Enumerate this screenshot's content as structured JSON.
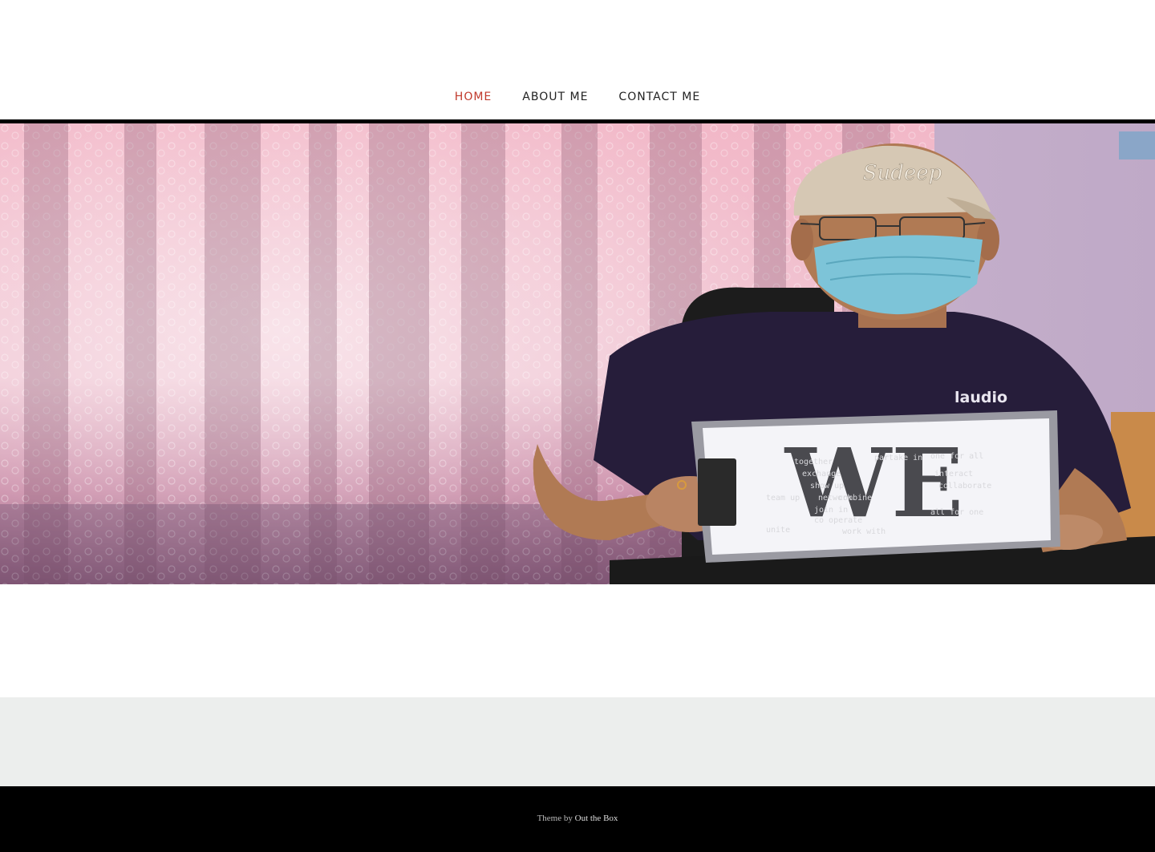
{
  "nav": {
    "items": [
      {
        "label": "HOME",
        "active": true
      },
      {
        "label": "ABOUT ME",
        "active": false
      },
      {
        "label": "CONTACT ME",
        "active": false
      }
    ]
  },
  "hero": {
    "cap_text": "Sudeep",
    "shirt_logo": "laudio",
    "sign": {
      "big_text": "WE",
      "words": [
        "together",
        "exchange",
        "show up",
        "team up",
        "network",
        "join in",
        "co operate",
        "unite",
        "one for all",
        "collaborate",
        "all for one",
        "work with",
        "combine",
        "partake in",
        "interact"
      ]
    },
    "colors": {
      "curtain": "#e9a4b8",
      "wall": "#cbb7cf",
      "shirt": "#241c38",
      "mask": "#7dc4d8"
    }
  },
  "footer": {
    "credit_prefix": "Theme by ",
    "credit_link": "Out the Box"
  }
}
